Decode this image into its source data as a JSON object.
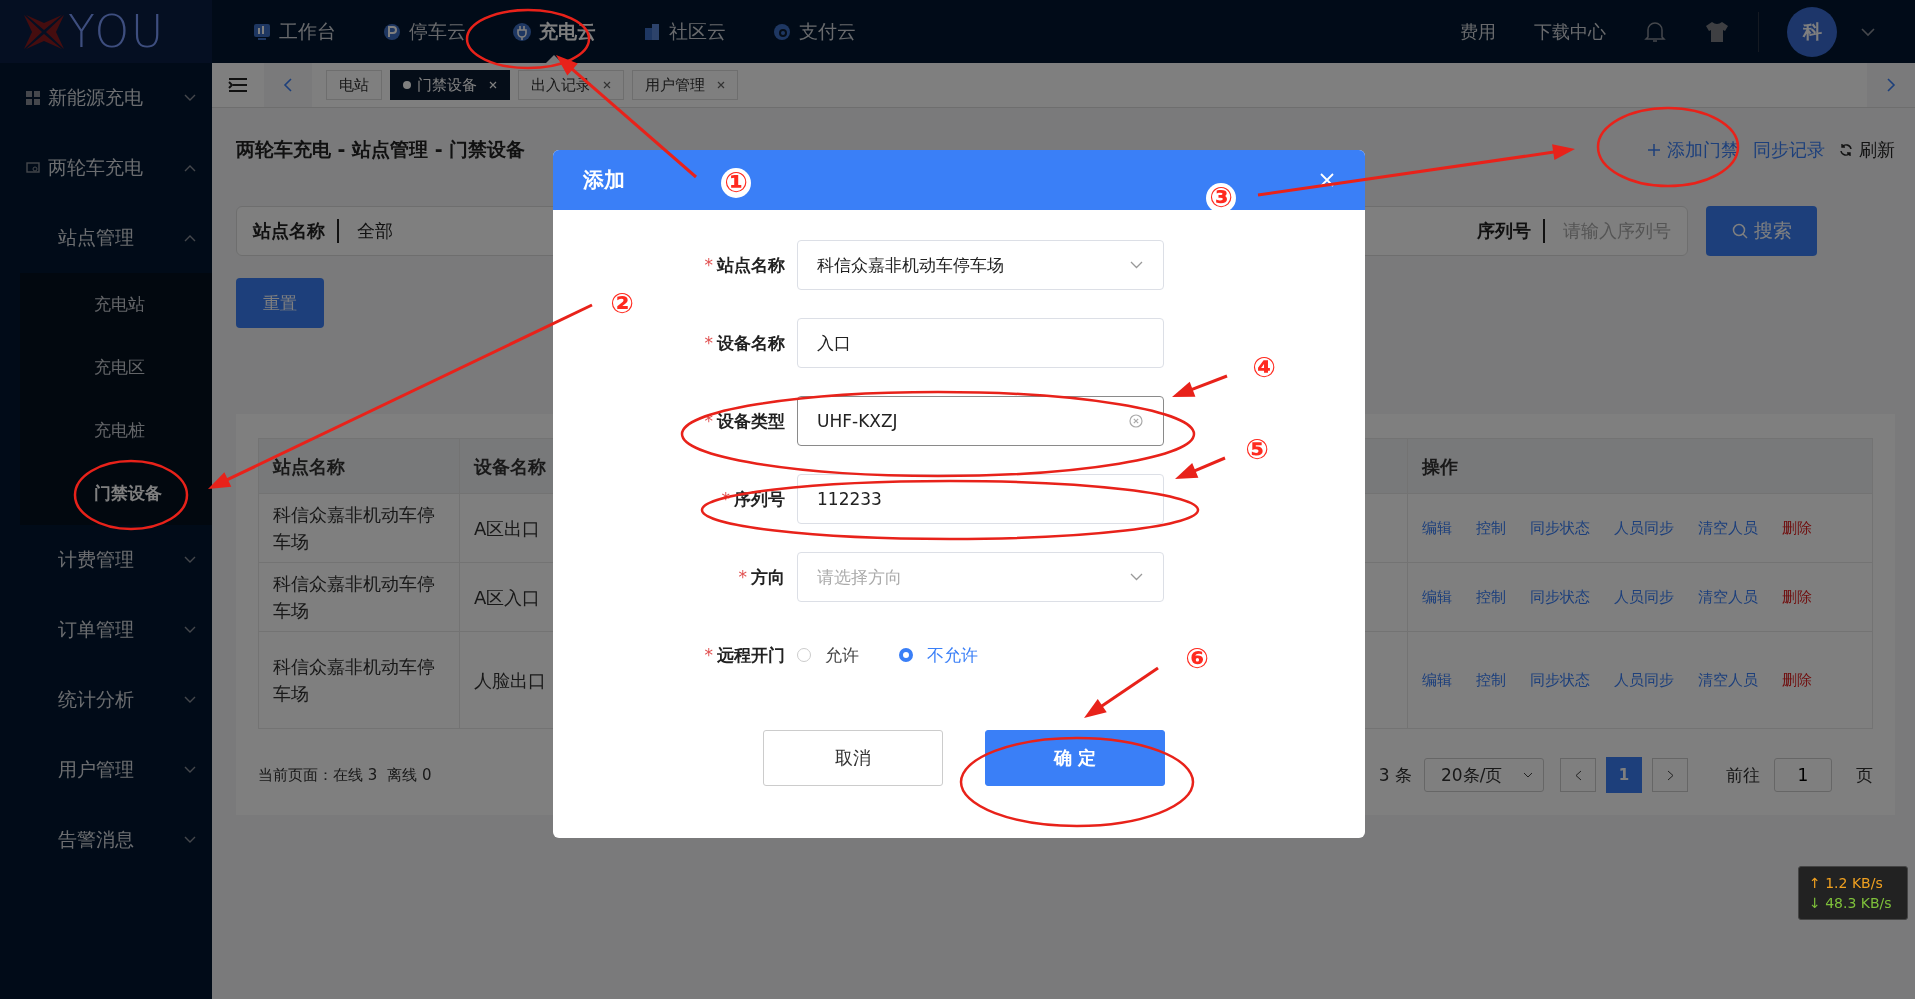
{
  "topbar": {
    "logo": "YOU",
    "nav": [
      {
        "label": "工作台",
        "selected": false
      },
      {
        "label": "停车云",
        "selected": false
      },
      {
        "label": "充电云",
        "selected": true
      },
      {
        "label": "社区云",
        "selected": false
      },
      {
        "label": "支付云",
        "selected": false
      }
    ],
    "links": [
      "费用",
      "下载中心"
    ],
    "avatar": "科"
  },
  "tabs": [
    {
      "label": "电站",
      "selected": false,
      "closable": false
    },
    {
      "label": "门禁设备",
      "selected": true,
      "closable": true
    },
    {
      "label": "出入记录",
      "selected": false,
      "closable": true
    },
    {
      "label": "用户管理",
      "selected": false,
      "closable": true
    }
  ],
  "sidebar": {
    "items": [
      {
        "label": "新能源充电",
        "expanded": false
      },
      {
        "label": "两轮车充电",
        "expanded": true,
        "children": [
          {
            "label": "站点管理",
            "expanded": true,
            "children": [
              {
                "label": "充电站",
                "selected": false
              },
              {
                "label": "充电区",
                "selected": false
              },
              {
                "label": "充电桩",
                "selected": false
              },
              {
                "label": "门禁设备",
                "selected": true
              }
            ]
          },
          {
            "label": "计费管理",
            "expanded": false
          },
          {
            "label": "订单管理",
            "expanded": false
          },
          {
            "label": "统计分析",
            "expanded": false
          },
          {
            "label": "用户管理",
            "expanded": false
          },
          {
            "label": "告警消息",
            "expanded": false
          }
        ]
      }
    ]
  },
  "page": {
    "title": "两轮车充电 - 站点管理 - 门禁设备",
    "actions": [
      "添加门禁",
      "同步记录",
      "刷新"
    ],
    "filters": [
      {
        "label": "站点名称",
        "value": "全部"
      },
      {
        "label": "序列号",
        "placeholder": "请输入序列号"
      }
    ],
    "search_button": "搜索",
    "reset_button": "重置",
    "table": {
      "columns": [
        "站点名称",
        "设备名称",
        "操作"
      ],
      "rows": [
        {
          "site": "科信众嘉非机动车停车场",
          "device": "A区出口",
          "actions": [
            {
              "label": "编辑",
              "kind": "link"
            },
            {
              "label": "控制",
              "kind": "link"
            },
            {
              "label": "同步状态",
              "kind": "link"
            },
            {
              "label": "人员同步",
              "kind": "link"
            },
            {
              "label": "清空人员",
              "kind": "link"
            },
            {
              "label": "删除",
              "kind": "danger"
            }
          ]
        },
        {
          "site": "科信众嘉非机动车停车场",
          "device": "A区入口",
          "actions": [
            {
              "label": "编辑",
              "kind": "link"
            },
            {
              "label": "控制",
              "kind": "link"
            },
            {
              "label": "同步状态",
              "kind": "link"
            },
            {
              "label": "人员同步",
              "kind": "link"
            },
            {
              "label": "清空人员",
              "kind": "link"
            },
            {
              "label": "删除",
              "kind": "danger"
            }
          ]
        },
        {
          "site": "科信众嘉非机动车停车场",
          "device": "人脸出口",
          "actions": [
            {
              "label": "编辑",
              "kind": "link"
            },
            {
              "label": "控制",
              "kind": "link"
            },
            {
              "label": "同步状态",
              "kind": "link"
            },
            {
              "label": "人员同步",
              "kind": "link"
            },
            {
              "label": "清空人员",
              "kind": "link"
            },
            {
              "label": "删除",
              "kind": "danger"
            }
          ]
        }
      ]
    },
    "status": [
      "当前页面：在线 3",
      "离线 0"
    ],
    "pagination": {
      "total": "3 条",
      "page_size": "20条/页",
      "pages": [
        {
          "label": "1",
          "selected": true
        }
      ],
      "goto_label": "前往",
      "goto_value": "1",
      "goto_suffix": "页"
    }
  },
  "dialog": {
    "title": "添加",
    "fields": [
      {
        "kind": "select",
        "label": "站点名称",
        "required_mark": "*",
        "value": "科信众嘉非机动车停车场"
      },
      {
        "kind": "input",
        "label": "设备名称",
        "required_mark": "*",
        "value": "入口"
      },
      {
        "kind": "input",
        "label": "设备类型",
        "required_mark": "*",
        "value": "UHF-KXZJ",
        "focused": true
      },
      {
        "kind": "input",
        "label": "序列号",
        "required_mark": "*",
        "value": "112233"
      },
      {
        "kind": "select",
        "label": "方向",
        "required_mark": "*",
        "placeholder": "请选择方向"
      },
      {
        "kind": "radio",
        "label": "远程开门",
        "required_mark": "*",
        "options": [
          {
            "label": "允许",
            "selected": false
          },
          {
            "label": "不允许",
            "selected": true
          }
        ]
      }
    ],
    "buttons": [
      {
        "label": "取消",
        "kind": "default"
      },
      {
        "label": "确 定",
        "kind": "primary"
      }
    ]
  },
  "annotations": {
    "markers": [
      "①",
      "②",
      "③",
      "④",
      "⑤",
      "⑥"
    ]
  },
  "network_speed": {
    "upload": "↑ 1.2 KB/s",
    "download": "↓ 48.3 KB/s"
  }
}
